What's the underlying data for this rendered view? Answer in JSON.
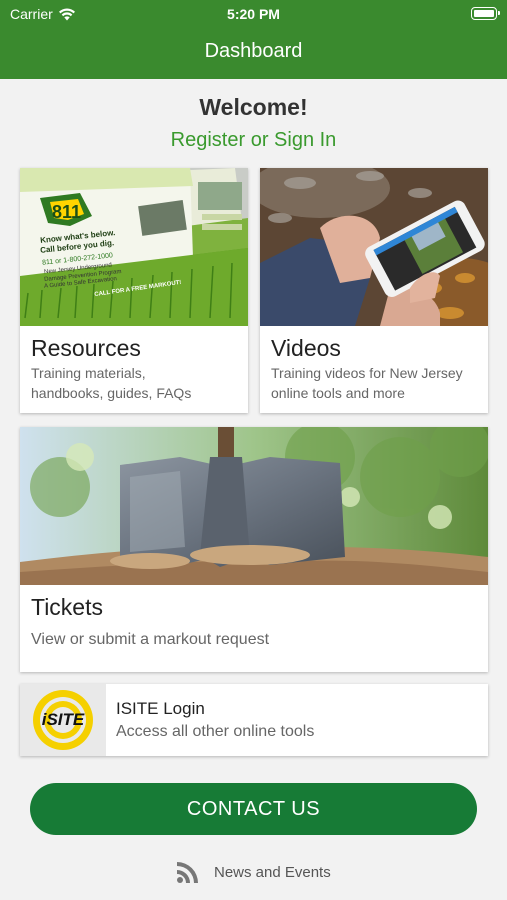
{
  "status": {
    "carrier": "Carrier",
    "time": "5:20 PM"
  },
  "header": {
    "title": "Dashboard"
  },
  "welcome": {
    "heading": "Welcome!",
    "link": "Register or Sign In"
  },
  "cards": {
    "resources": {
      "title": "Resources",
      "description_line1": "Training materials,",
      "description_line2": "handbooks, guides, FAQs"
    },
    "videos": {
      "title": "Videos",
      "description_line1": "Training videos for New Jersey",
      "description_line2": "online tools and more"
    },
    "tickets": {
      "title": "Tickets",
      "description": "View or submit a markout request"
    },
    "isite": {
      "title": "ISITE Login",
      "description": "Access all other online tools",
      "logo_text": "iSITE"
    }
  },
  "resources_image": {
    "badge": "811",
    "lines": [
      "Know what's below.",
      "Call before you dig.",
      "811 or 1-800-272-1000",
      "New Jersey Underground",
      "Damage Prevention Program",
      "A Guide to Safe Excavation",
      "CALL FOR A FREE MARKOUT!"
    ]
  },
  "contact_button": {
    "label": "CONTACT US"
  },
  "news": {
    "label": "News and Events",
    "icon": "rss-icon"
  },
  "colors": {
    "header": "#3a8a2e",
    "link": "#3a9a2e",
    "button": "#177b36",
    "logo_ring": "#f5d000"
  }
}
